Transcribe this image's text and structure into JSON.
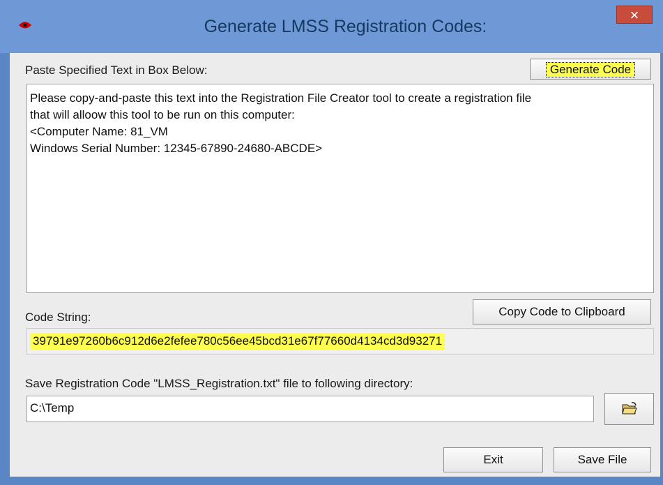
{
  "window": {
    "title": "Generate LMSS Registration Codes:",
    "close_glyph": "×",
    "accent_color": "#6f98d6",
    "highlight_color": "#ffff4f"
  },
  "paste_section": {
    "label": "Paste Specified Text in Box Below:",
    "generate_button": "Generate Code",
    "lines": [
      "Please copy-and-paste this text into the Registration File Creator tool to create a registration file",
      "that will alloow this tool to be run on this computer:",
      "",
      "<Computer Name: 81_VM",
      "Windows Serial Number: 12345-67890-24680-ABCDE>"
    ]
  },
  "code_section": {
    "label": "Code String:",
    "copy_button": "Copy Code to Clipboard",
    "value": "39791e97260b6c912d6e2fefee780c56ee45bcd31e67f77660d4134cd3d93271"
  },
  "save_section": {
    "label": "Save Registration Code \"LMSS_Registration.txt\" file to following directory:",
    "directory": "C:\\Temp",
    "folder_icon": "open-folder-icon"
  },
  "footer": {
    "exit_button": "Exit",
    "save_button": "Save File"
  }
}
